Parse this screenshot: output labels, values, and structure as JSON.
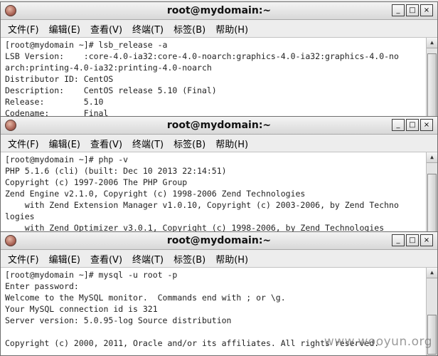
{
  "menu_labels": [
    "文件(F)",
    "编辑(E)",
    "查看(V)",
    "终端(T)",
    "标签(B)",
    "帮助(H)"
  ],
  "window_buttons": {
    "minimize": "_",
    "maximize": "□",
    "close": "×"
  },
  "win1": {
    "title": "root@mydomain:~",
    "lines": [
      "[root@mydomain ~]# lsb_release -a",
      "LSB Version:    :core-4.0-ia32:core-4.0-noarch:graphics-4.0-ia32:graphics-4.0-no",
      "arch:printing-4.0-ia32:printing-4.0-noarch",
      "Distributor ID: CentOS",
      "Description:    CentOS release 5.10 (Final)",
      "Release:        5.10",
      "Codename:       Final"
    ]
  },
  "win2": {
    "title": "root@mydomain:~",
    "lines": [
      "[root@mydomain ~]# php -v",
      "PHP 5.1.6 (cli) (built: Dec 10 2013 22:14:51)",
      "Copyright (c) 1997-2006 The PHP Group",
      "Zend Engine v2.1.0, Copyright (c) 1998-2006 Zend Technologies",
      "    with Zend Extension Manager v1.0.10, Copyright (c) 2003-2006, by Zend Techno",
      "logies",
      "    with Zend Optimizer v3.0.1, Copyright (c) 1998-2006, by Zend Technologies"
    ]
  },
  "win3": {
    "title": "root@mydomain:~",
    "lines": [
      "[root@mydomain ~]# mysql -u root -p",
      "Enter password:",
      "Welcome to the MySQL monitor.  Commands end with ; or \\g.",
      "Your MySQL connection id is 321",
      "Server version: 5.0.95-log Source distribution",
      "",
      "Copyright (c) 2000, 2011, Oracle and/or its affiliates. All rights reserved."
    ]
  },
  "watermark": "www.wooyun.org"
}
